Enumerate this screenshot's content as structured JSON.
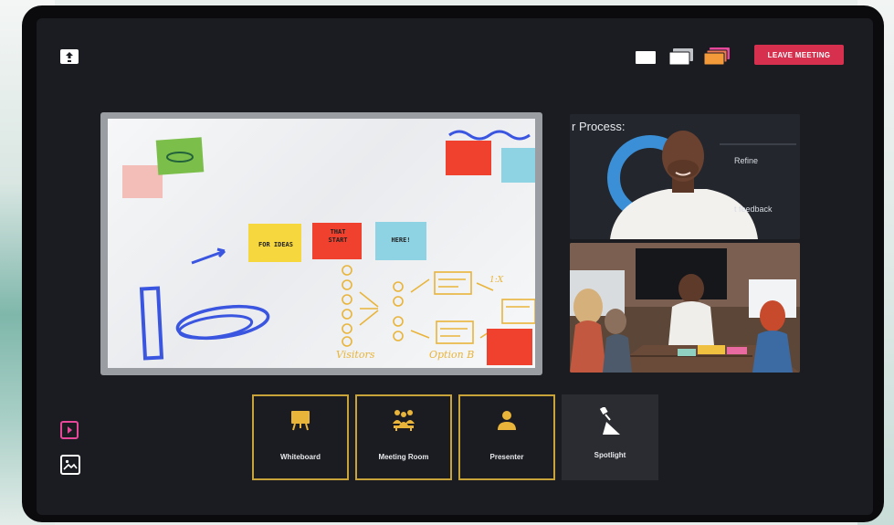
{
  "header": {
    "share_icon": "screen-share-icon",
    "layout_icons": [
      "single-layout-icon",
      "stacked-layout-icon",
      "multi-layout-icon"
    ],
    "leave_button": "LEAVE MEETING"
  },
  "whiteboard_notes": {
    "note1": "FOR IDEAS",
    "note2a": "THAT",
    "note2b": "START",
    "note3": "HERE!",
    "label_visitors": "Visitors",
    "label_option": "Option B",
    "label_1x": "1:X"
  },
  "video_top": {
    "slide_title": "r Process:",
    "slide_refine": "Refine",
    "slide_feedback": "t feedback"
  },
  "sidebar": {
    "icons": [
      "play-icon",
      "image-icon"
    ]
  },
  "tiles": [
    {
      "label": "Whiteboard",
      "icon": "whiteboard-icon",
      "selected": true
    },
    {
      "label": "Meeting Room",
      "icon": "meeting-room-icon",
      "selected": true
    },
    {
      "label": "Presenter",
      "icon": "presenter-icon",
      "selected": true
    },
    {
      "label": "Spotlight",
      "icon": "spotlight-icon",
      "selected": false
    }
  ],
  "colors": {
    "accent_gold": "#c8a33a",
    "leave_red": "#d7304f",
    "play_pink": "#e8489a"
  }
}
